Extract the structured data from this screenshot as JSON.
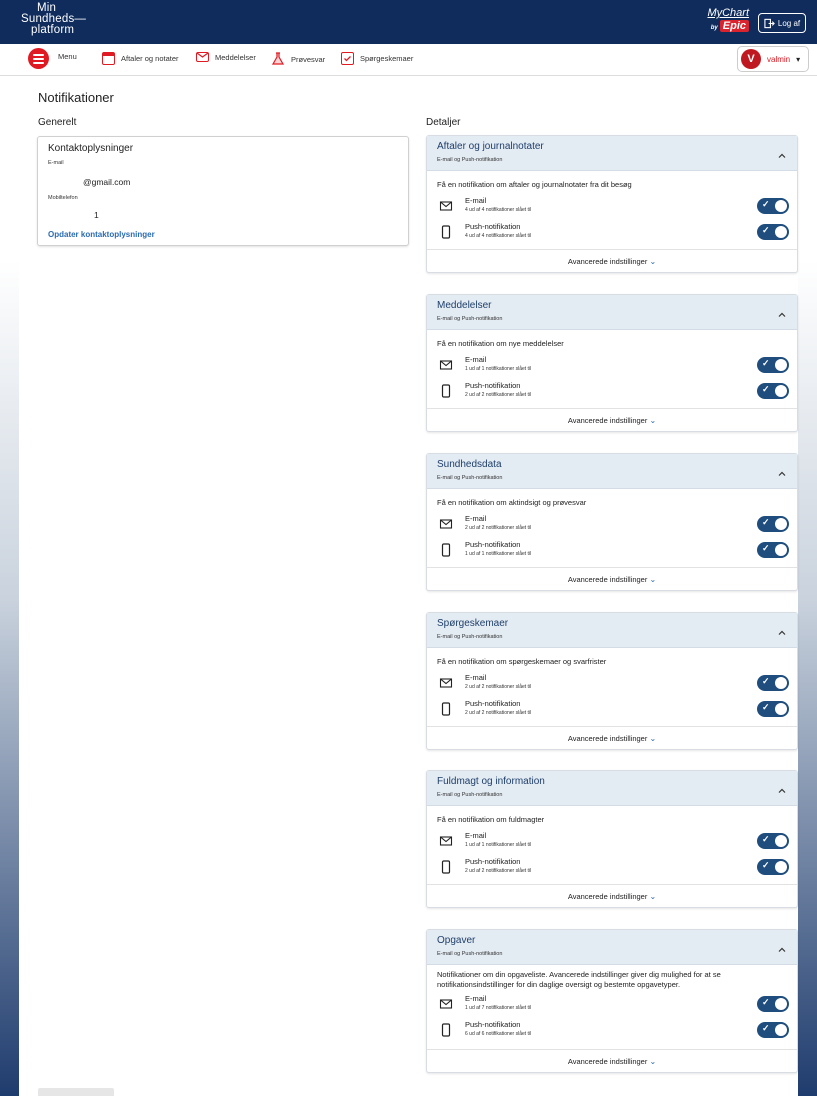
{
  "header": {
    "logo_line1": "Min",
    "logo_line2": "Sundheds—",
    "logo_line3": "platform",
    "mychart_label": "MyChart",
    "mychart_by": "by",
    "epic_label": "Epic",
    "logout_label": "Log af"
  },
  "nav": {
    "menu_label": "Menu",
    "items": [
      {
        "label": "Aftaler og notater",
        "icon": "calendar-icon"
      },
      {
        "label": "Meddelelser",
        "icon": "envelope-icon"
      },
      {
        "label": "Prøvesvar",
        "icon": "flask-icon"
      },
      {
        "label": "Spørgeskemaer",
        "icon": "checklist-icon"
      }
    ],
    "user_initial": "V",
    "user_name": "valmin"
  },
  "page": {
    "title": "Notifikationer",
    "general_label": "Generelt",
    "details_label": "Detaljer"
  },
  "contact": {
    "title": "Kontaktoplysninger",
    "email_label": "E-mail",
    "email_value": "@gmail.com",
    "phone_label": "Mobiltelefon",
    "phone_value": "1",
    "update_link": "Opdater kontaktoplysninger"
  },
  "cards": [
    {
      "title": "Aftaler og journalnotater",
      "subtitle": "E-mail og Push-notifikation",
      "description": "Få en notifikation om aftaler og journalnotater fra dit besøg",
      "email_label": "E-mail",
      "email_count": "4 ud af 4 notifikationer slået til",
      "push_label": "Push-notifikation",
      "push_count": "4 ud af 4 notifikationer slået til",
      "advanced": "Avancerede indstillinger"
    },
    {
      "title": "Meddelelser",
      "subtitle": "E-mail og Push-notifikation",
      "description": "Få en notifikation om nye meddelelser",
      "email_label": "E-mail",
      "email_count": "1 ud af 1 notifikationer slået til",
      "push_label": "Push-notifikation",
      "push_count": "2 ud af 2 notifikationer slået til",
      "advanced": "Avancerede indstillinger"
    },
    {
      "title": "Sundhedsdata",
      "subtitle": "E-mail og Push-notifikation",
      "description": "Få en notifikation om aktindsigt og prøvesvar",
      "email_label": "E-mail",
      "email_count": "2 ud af 2 notifikationer slået til",
      "push_label": "Push-notifikation",
      "push_count": "1 ud af 1 notifikationer slået til",
      "advanced": "Avancerede indstillinger"
    },
    {
      "title": "Spørgeskemaer",
      "subtitle": "E-mail og Push-notifikation",
      "description": "Få en notifikation om spørgeskemaer og svarfrister",
      "email_label": "E-mail",
      "email_count": "2 ud af 2 notifikationer slået til",
      "push_label": "Push-notifikation",
      "push_count": "2 ud af 2 notifikationer slået til",
      "advanced": "Avancerede indstillinger"
    },
    {
      "title": "Fuldmagt og information",
      "subtitle": "E-mail og Push-notifikation",
      "description": "Få en notifikation om fuldmagter",
      "email_label": "E-mail",
      "email_count": "1 ud af 1 notifikationer slået til",
      "push_label": "Push-notifikation",
      "push_count": "2 ud af 2 notifikationer slået til",
      "advanced": "Avancerede indstillinger"
    },
    {
      "title": "Opgaver",
      "subtitle": "E-mail og Push-notifikation",
      "description": "Notifikationer om din opgaveliste. Avancerede indstillinger giver dig mulighed for at se notifikationsindstillinger for din daglige oversigt og bestemte opgavetyper.",
      "email_label": "E-mail",
      "email_count": "1 ud af 7 notifikationer slået til",
      "push_label": "Push-notifikation",
      "push_count": "6 ud af 6 notifikationer slået til",
      "advanced": "Avancerede indstillinger"
    }
  ],
  "colors": {
    "header_bg": "#0f2c5c",
    "accent_red": "#e01a22",
    "toggle_on": "#1f4e7e",
    "card_header_bg": "#e3ebf3",
    "link": "#2a6bb0"
  }
}
